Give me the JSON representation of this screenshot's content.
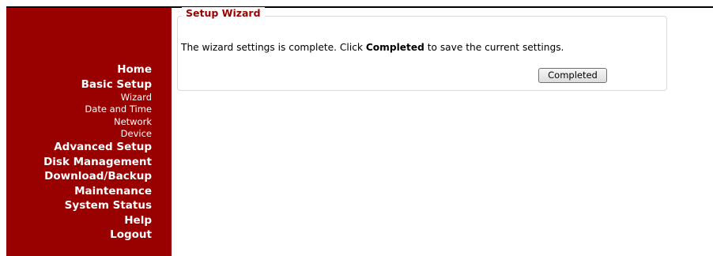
{
  "sidebar": {
    "items": [
      {
        "label": "Home",
        "level": "main"
      },
      {
        "label": "Basic Setup",
        "level": "main"
      },
      {
        "label": "Wizard",
        "level": "sub"
      },
      {
        "label": "Date and Time",
        "level": "sub"
      },
      {
        "label": "Network",
        "level": "sub"
      },
      {
        "label": "Device",
        "level": "sub"
      },
      {
        "label": "Advanced Setup",
        "level": "main"
      },
      {
        "label": "Disk Management",
        "level": "main"
      },
      {
        "label": "Download/Backup",
        "level": "main"
      },
      {
        "label": "Maintenance",
        "level": "main"
      },
      {
        "label": "System Status",
        "level": "main"
      },
      {
        "label": "Help",
        "level": "main"
      },
      {
        "label": "Logout",
        "level": "main"
      }
    ]
  },
  "wizard": {
    "legend": "Setup Wizard",
    "message_before": "The wizard settings is complete. Click ",
    "message_bold": "Completed",
    "message_after": " to save the current settings.",
    "button_label": "Completed"
  },
  "colors": {
    "sidebar_bg": "#990000",
    "legend_text": "#990000",
    "nav_text": "#ffffff"
  }
}
